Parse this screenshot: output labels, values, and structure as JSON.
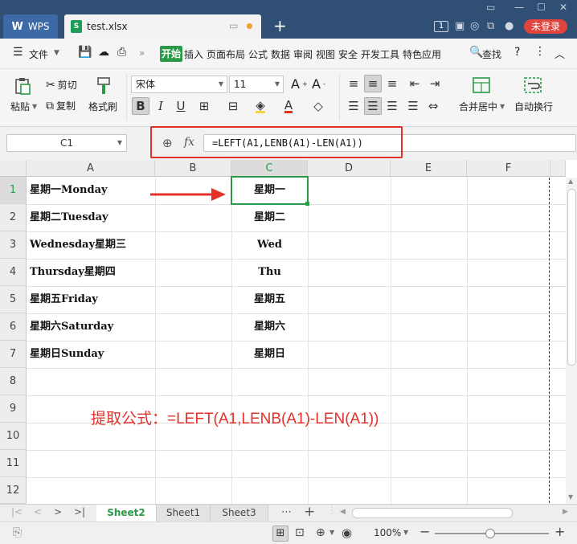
{
  "titlebar": {
    "wps_tab": "WPS",
    "file_tab": "test.xlsx",
    "page_count_badge": "1",
    "login_button": "未登录"
  },
  "menubar": {
    "file_menu": "文件",
    "tabs": [
      "开始",
      "插入",
      "页面布局",
      "公式",
      "数据",
      "审阅",
      "视图",
      "安全",
      "开发工具",
      "特色应用"
    ],
    "active_tab": "开始",
    "search": "查找"
  },
  "ribbon": {
    "paste": "粘贴",
    "cut": "剪切",
    "copy": "复制",
    "format_painter": "格式刷",
    "font_name": "宋体",
    "font_size": "11",
    "merge_center": "合并居中",
    "wrap_text": "自动换行"
  },
  "formula_bar": {
    "name_box": "C1",
    "fx_label": "fx",
    "formula": "=LEFT(A1,LENB(A1)-LEN(A1))"
  },
  "grid": {
    "columns": [
      "A",
      "B",
      "C",
      "D",
      "E",
      "F"
    ],
    "active_column": "C",
    "rows": [
      "1",
      "2",
      "3",
      "4",
      "5",
      "6",
      "7",
      "8",
      "9",
      "10",
      "11",
      "12"
    ],
    "active_row": "1",
    "col_a": [
      "星期一Monday",
      "星期二Tuesday",
      "Wednesday星期三",
      "Thursday星期四",
      "星期五Friday",
      "星期六Saturday",
      "星期日Sunday"
    ],
    "col_c": [
      "星期一",
      "星期二",
      "Wed",
      "Thu",
      "星期五",
      "星期六",
      "星期日"
    ],
    "annotation": "提取公式：=LEFT(A1,LENB(A1)-LEN(A1))"
  },
  "sheets": {
    "tabs": [
      "Sheet2",
      "Sheet1",
      "Sheet3"
    ],
    "active": "Sheet2"
  },
  "status": {
    "zoom": "100%"
  },
  "colors": {
    "accent_green": "#2b9a48",
    "annotation_red": "#e5302a",
    "titlebar": "#2f4f75"
  }
}
